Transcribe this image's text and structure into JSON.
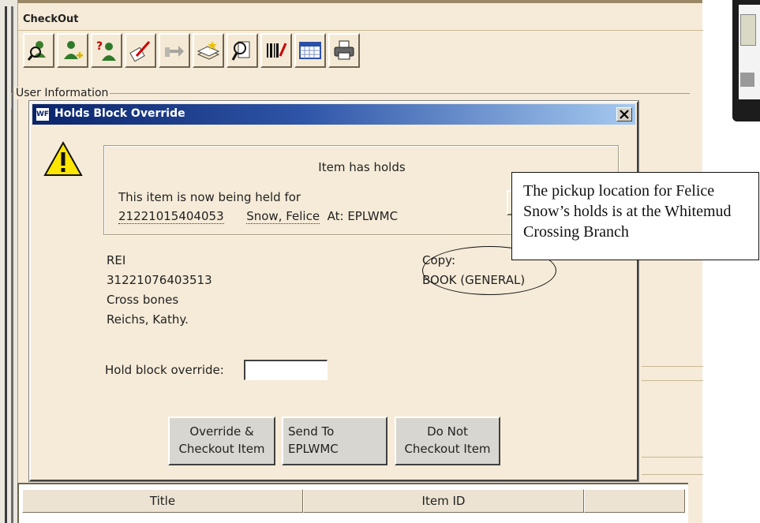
{
  "window": {
    "title": "CheckOut"
  },
  "toolbar": {
    "buttons": [
      {
        "icon": "user-search-icon"
      },
      {
        "icon": "add-user-icon"
      },
      {
        "icon": "user-help-icon"
      },
      {
        "icon": "edit-icon"
      },
      {
        "icon": "hand-disabled-icon"
      },
      {
        "icon": "books-icon"
      },
      {
        "icon": "magnifier-list-icon"
      },
      {
        "icon": "barcode-icon"
      },
      {
        "icon": "calendar-grid-icon"
      },
      {
        "icon": "printer-icon"
      }
    ]
  },
  "user_info": {
    "label": "User Information"
  },
  "dialog": {
    "app_icon_text": "WF",
    "title": "Holds Block Override",
    "close_symbol": "×",
    "message": {
      "heading": "Item has holds",
      "line1": "This item is now being held for",
      "user_id": "21221015404053",
      "user_name": "Snow, Felice",
      "at_label": "At: EPLWMC"
    },
    "item": {
      "call_prefix": "REI",
      "item_id": "31221076403513",
      "title": "Cross bones",
      "author": "Reichs, Kathy."
    },
    "copy": {
      "label": "Copy:",
      "type": "BOOK (GENERAL)"
    },
    "override": {
      "label": "Hold block override:",
      "value": ""
    },
    "buttons": {
      "override_checkout": "Override &\nCheckout Item",
      "send_to": "Send To\nEPLWMC",
      "do_not_checkout": "Do Not\nCheckout Item"
    }
  },
  "table": {
    "columns": [
      "Title",
      "Item ID",
      ""
    ]
  },
  "callout": {
    "text": "The pickup location for Felice Snow’s holds is at the Whitemud Crossing Branch"
  },
  "colors": {
    "window_bg": "#f6ebd8",
    "titlebar_dark": "#0a246a",
    "titlebar_light": "#a6caf0",
    "warning_yellow": "#ffe600"
  }
}
